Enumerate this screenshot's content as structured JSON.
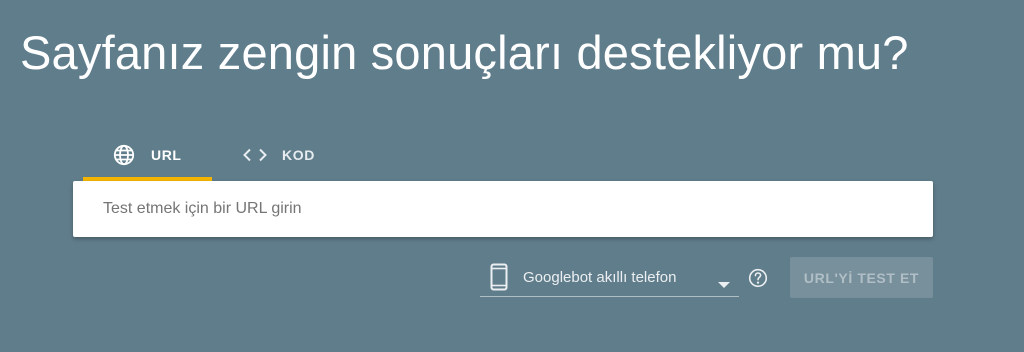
{
  "title": "Sayfanız zengin sonuçları destekliyor mu?",
  "tabs": [
    {
      "label": "URL",
      "icon": "globe-icon",
      "active": true
    },
    {
      "label": "KOD",
      "icon": "code-icon",
      "active": false
    }
  ],
  "url_input": {
    "placeholder": "Test etmek için bir URL girin",
    "value": ""
  },
  "device_select": {
    "icon": "smartphone-icon",
    "selected": "Googlebot akıllı telefon"
  },
  "help": {
    "icon": "help-circle-icon"
  },
  "test_button": {
    "label": "URL'Yİ TEST ET",
    "enabled": false
  },
  "colors": {
    "background": "#607d8b",
    "tab_indicator": "#f4b400",
    "button_disabled": "#78909c"
  }
}
